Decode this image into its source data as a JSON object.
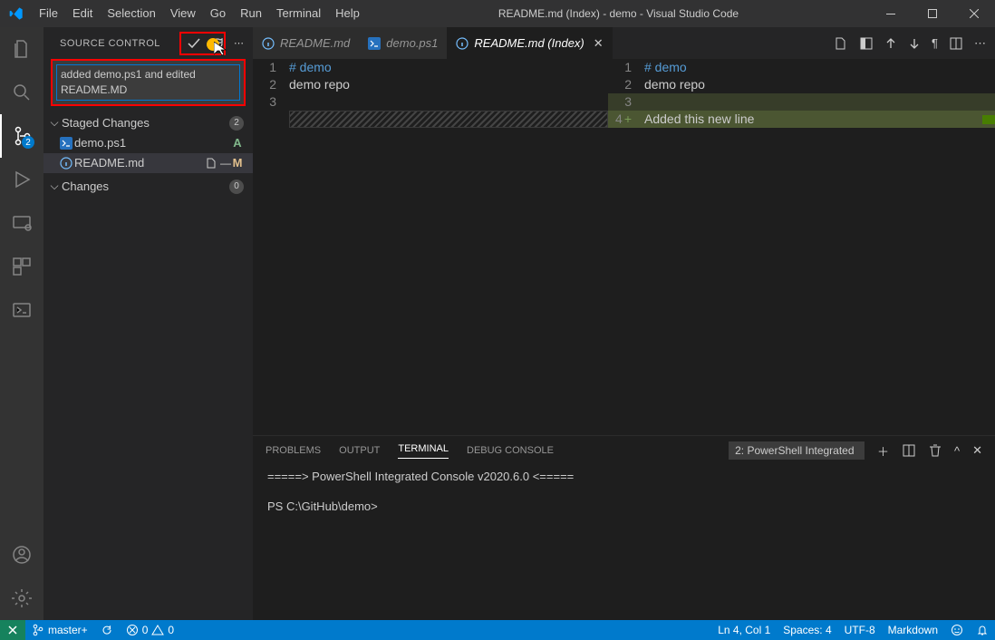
{
  "title": "README.md (Index) - demo - Visual Studio Code",
  "menu": [
    "File",
    "Edit",
    "Selection",
    "View",
    "Go",
    "Run",
    "Terminal",
    "Help"
  ],
  "sidebar": {
    "title": "SOURCE CONTROL",
    "ellipsis": "⋯",
    "commit_message": "added demo.ps1 and edited README.MD",
    "staged": {
      "label": "Staged Changes",
      "count": "2"
    },
    "files": [
      {
        "name": "demo.ps1",
        "status": "A"
      },
      {
        "name": "README.md",
        "status": "M"
      }
    ],
    "changes": {
      "label": "Changes",
      "count": "0"
    }
  },
  "activity_badge": "2",
  "tabs": [
    {
      "label": "README.md"
    },
    {
      "label": "demo.ps1"
    },
    {
      "label": "README.md (Index)"
    }
  ],
  "editor_left": {
    "l1": "# demo",
    "l2": "demo repo",
    "l3": ""
  },
  "editor_right": {
    "l1": "# demo",
    "l2": "demo repo",
    "l3": "",
    "l4": "Added this new line"
  },
  "panel": {
    "tabs": [
      "PROBLEMS",
      "OUTPUT",
      "TERMINAL",
      "DEBUG CONSOLE"
    ],
    "selector": "2: PowerShell Integrated",
    "line1": "=====> PowerShell Integrated Console v2020.6.0 <=====",
    "line2": "PS C:\\GitHub\\demo>"
  },
  "statusbar": {
    "branch": "master+",
    "errors": "0",
    "warnings": "0",
    "cursor": "Ln 4, Col 1",
    "spaces": "Spaces: 4",
    "encoding": "UTF-8",
    "lang": "Markdown"
  }
}
